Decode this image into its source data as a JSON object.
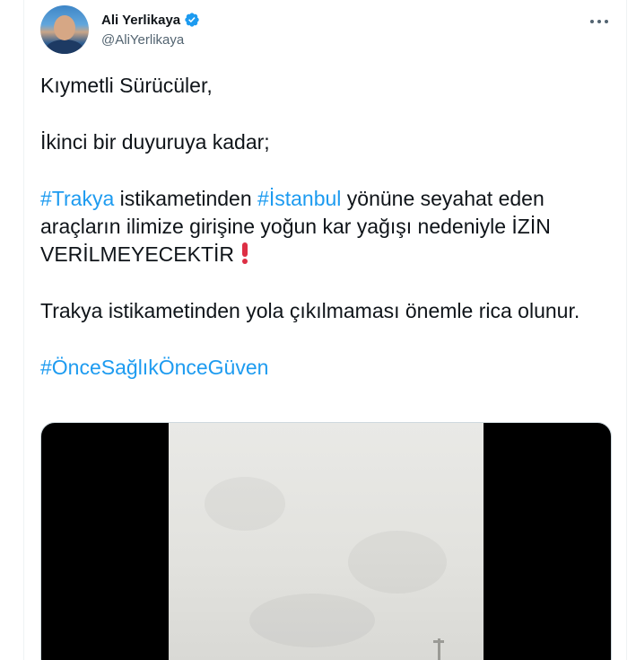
{
  "author": {
    "display_name": "Ali Yerlikaya",
    "handle": "@AliYerlikaya",
    "verified": true
  },
  "tweet": {
    "line1": "Kıymetli Sürücüler,",
    "line2": "İkinci bir duyuruya kadar;",
    "para3": {
      "hashtag1": "#Trakya",
      "text1": " istikametinden ",
      "hashtag2": "#İstanbul",
      "text2": " yönüne seyahat eden araçların ilimize girişine yoğun kar yağışı nedeniyle İZİN VERİLMEYECEKTİR"
    },
    "para4": "Trakya istikametinden yola çıkılmaması önemle rica olunur.",
    "hashtag_final": "#ÖnceSağlıkÖnceGüven"
  },
  "icons": {
    "verified": "verified-badge-icon",
    "more": "more-options-icon",
    "exclamation": "red-exclamation-icon"
  },
  "colors": {
    "link": "#1d9bf0",
    "text": "#0f1419",
    "secondary": "#536471",
    "verified": "#1d9bf0",
    "exclamation": "#dd2e44"
  }
}
